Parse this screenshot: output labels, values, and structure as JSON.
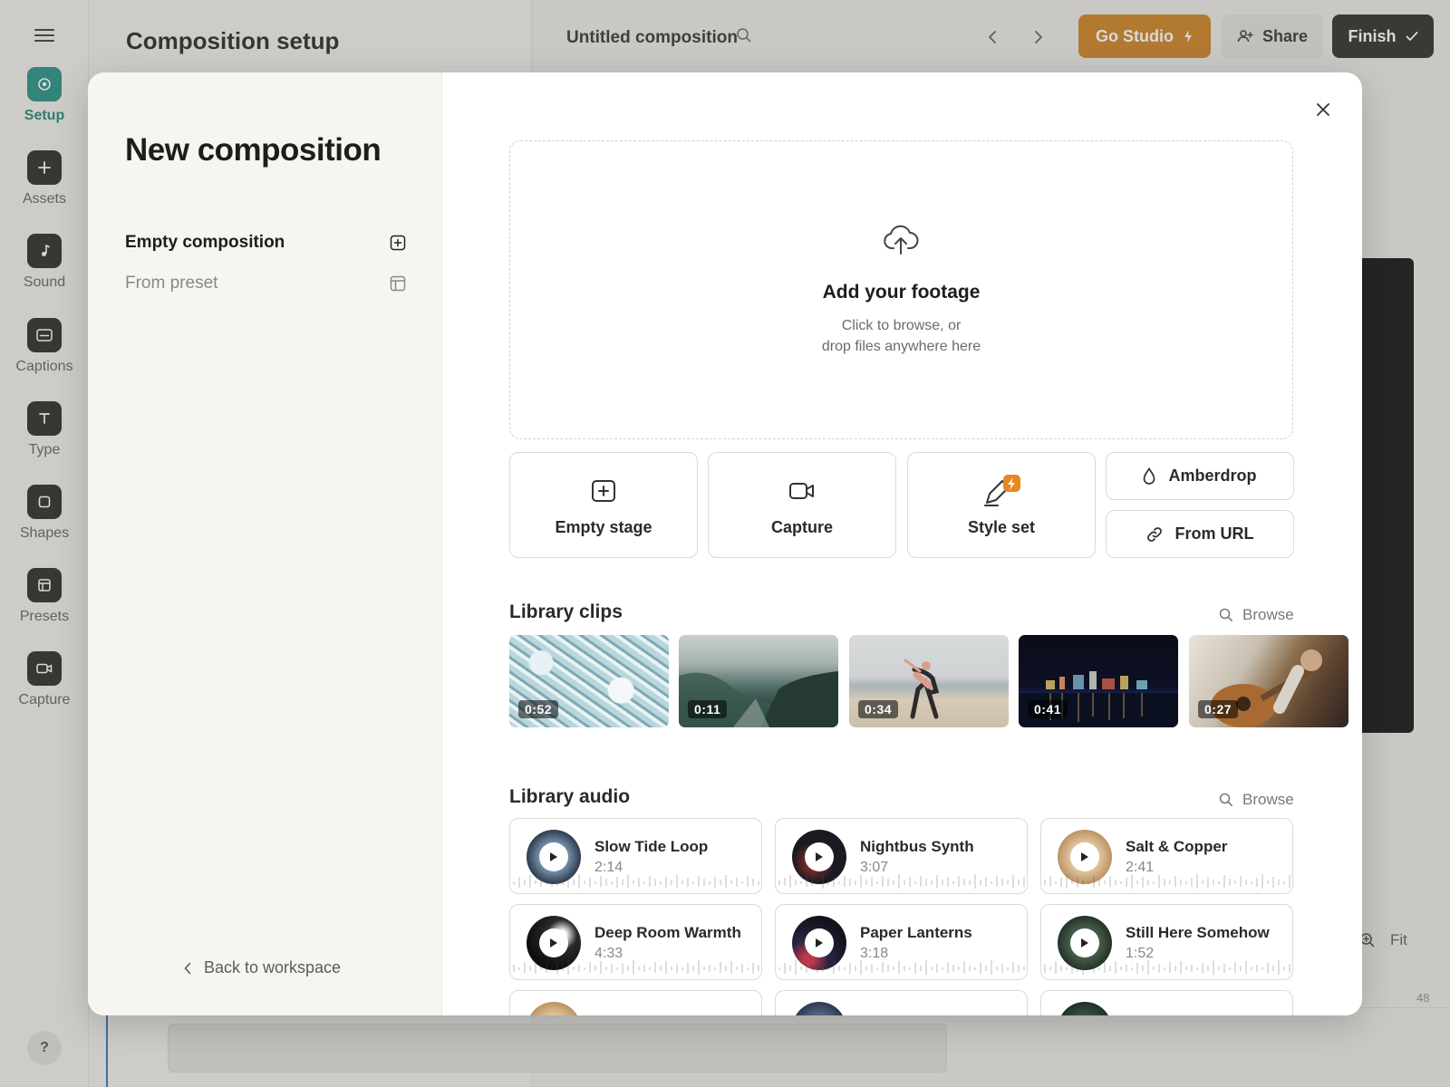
{
  "app": {
    "rail": [
      {
        "key": "setup",
        "label": "Setup",
        "icon": "target-icon",
        "active": true
      },
      {
        "key": "assets",
        "label": "Assets",
        "icon": "plus-icon"
      },
      {
        "key": "sound",
        "label": "Sound",
        "icon": "music-note-icon"
      },
      {
        "key": "captions",
        "label": "Captions",
        "icon": "captions-icon"
      },
      {
        "key": "type",
        "label": "Type",
        "icon": "text-icon"
      },
      {
        "key": "shapes",
        "label": "Shapes",
        "icon": "square-icon"
      },
      {
        "key": "presets",
        "label": "Presets",
        "icon": "layout-icon"
      },
      {
        "key": "capture",
        "label": "Capture",
        "icon": "video-camera-icon"
      }
    ],
    "help_label": "?",
    "panel_title": "Composition setup",
    "doc_title": "Untitled composition",
    "buttons": {
      "studio": "Go Studio",
      "share": "Share",
      "finish": "Finish"
    },
    "zoom_fit": "Fit",
    "timeline_marker": "48"
  },
  "modal": {
    "title": "New composition",
    "side_options": [
      {
        "label": "Empty composition",
        "icon": "plus-square-icon",
        "active": true
      },
      {
        "label": "From preset",
        "icon": "layout-icon",
        "active": false
      }
    ],
    "back_label": "Back to workspace",
    "dropzone": {
      "title": "Add your footage",
      "line1": "Click to browse, or",
      "line2": "drop files anywhere here"
    },
    "tiles": [
      {
        "label": "Empty stage",
        "icon": "plus-square-icon"
      },
      {
        "label": "Capture",
        "icon": "video-camera-icon"
      },
      {
        "label": "Style set",
        "icon": "pen-bolt-icon"
      }
    ],
    "pills": [
      {
        "label": "Amberdrop",
        "icon": "drop-icon"
      },
      {
        "label": "From URL",
        "icon": "link-icon"
      }
    ],
    "clips_section": {
      "title": "Library clips",
      "browse": "Browse"
    },
    "clips": [
      {
        "duration": "0:52",
        "scene": "ocean surf from above"
      },
      {
        "duration": "0:11",
        "scene": "misty mountain valley"
      },
      {
        "duration": "0:34",
        "scene": "person stretching on beach"
      },
      {
        "duration": "0:41",
        "scene": "city skyline at night"
      },
      {
        "duration": "0:27",
        "scene": "man playing guitar"
      }
    ],
    "audio_section": {
      "title": "Library audio",
      "browse": "Browse"
    },
    "tracks": [
      {
        "name": "Slow Tide Loop",
        "duration": "2:14",
        "disc": "#3d5066"
      },
      {
        "name": "Nightbus Synth",
        "duration": "3:07",
        "disc": "#1a1a22"
      },
      {
        "name": "Salt & Copper",
        "duration": "2:41",
        "disc": "#c9a479"
      },
      {
        "name": "Deep Room Warmth",
        "duration": "4:33",
        "disc": "#151515"
      },
      {
        "name": "Paper Lanterns",
        "duration": "3:18",
        "disc": "#1b1a2a"
      },
      {
        "name": "Still Here Somehow",
        "duration": "1:52",
        "disc": "#26352b"
      }
    ],
    "colors": {
      "accent": "#1a8a7e",
      "studio": "#c97a1a",
      "bolt_badge": "#e8871e"
    }
  }
}
